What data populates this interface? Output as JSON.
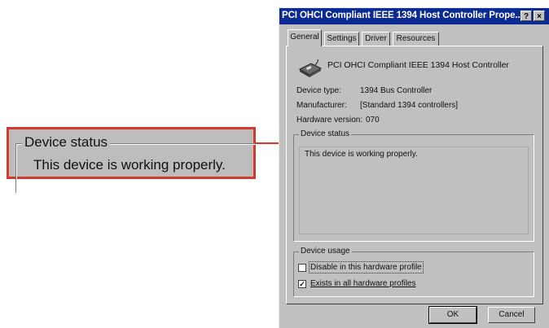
{
  "callout": {
    "legend": "Device status",
    "text": "This device is working properly."
  },
  "window": {
    "title": "PCI OHCI Compliant IEEE 1394 Host Controller Prope...",
    "help_glyph": "?",
    "close_glyph": "×"
  },
  "tabs": [
    {
      "label": "General"
    },
    {
      "label": "Settings"
    },
    {
      "label": "Driver"
    },
    {
      "label": "Resources"
    }
  ],
  "device": {
    "name": "PCI OHCI Compliant IEEE 1394 Host Controller",
    "properties": [
      {
        "label": "Device type:",
        "value": "1394 Bus Controller"
      },
      {
        "label": "Manufacturer:",
        "value": "[Standard 1394 controllers]"
      },
      {
        "label": "Hardware version:",
        "value": "070"
      }
    ]
  },
  "status": {
    "legend": "Device status",
    "text": "This device is working properly."
  },
  "usage": {
    "legend": "Device usage",
    "options": [
      {
        "label": "Disable in this hardware profile",
        "checked": false
      },
      {
        "label": "Exists in all hardware profiles",
        "checked": true
      }
    ]
  },
  "buttons": {
    "ok": "OK",
    "cancel": "Cancel"
  },
  "colors": {
    "titlebar": "#0b2a92",
    "callout_border": "#d43a2c",
    "face": "#c0c0c0"
  }
}
